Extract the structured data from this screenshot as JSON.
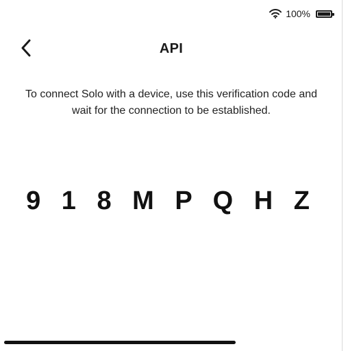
{
  "status_bar": {
    "wifi_icon": "wifi-icon",
    "battery_text": "100%",
    "battery_icon": "battery-icon",
    "battery_level": 1.0
  },
  "header": {
    "back_icon": "chevron-left-icon",
    "title": "API"
  },
  "main": {
    "instructions": "To connect Solo with a device, use this verification code and wait for the connection to be established.",
    "verification_code": "9 1 8 M P Q H Z"
  }
}
